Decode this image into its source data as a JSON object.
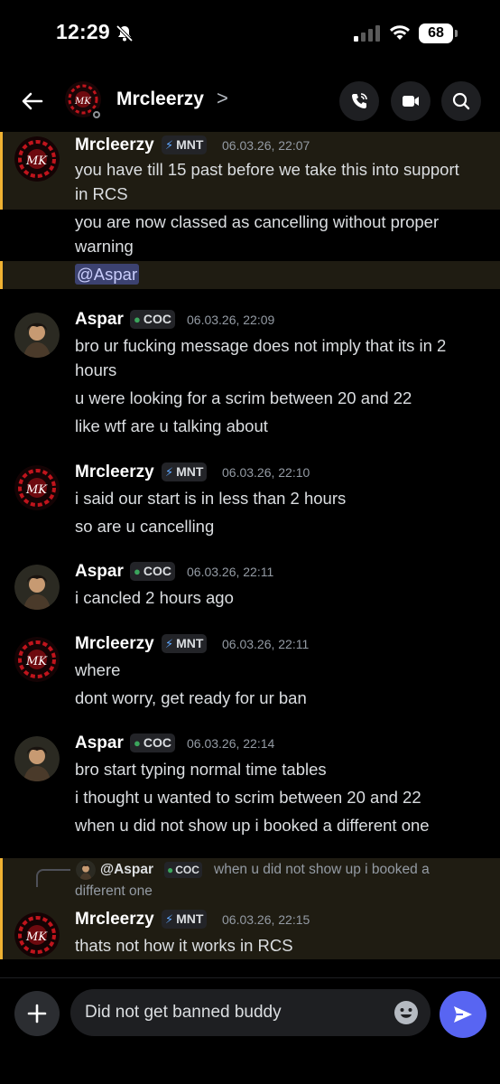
{
  "status_bar": {
    "time": "12:29",
    "battery": "68"
  },
  "header": {
    "name": "Mrcleerzy",
    "chevron": ">"
  },
  "messages": [
    {
      "user": "Mrcleerzy",
      "tag": "MNT",
      "time": "06.03.26, 22:07",
      "lines": [
        "you have till 15 past before we take this into support",
        "in RCS",
        "you are now classed as cancelling without proper",
        "warning",
        "@Aspar"
      ]
    },
    {
      "user": "Aspar",
      "tag": "COC",
      "time": "06.03.26, 22:09",
      "lines": [
        "bro ur fucking message does not imply that its in 2",
        "hours",
        "u were looking for a scrim between 20 and 22",
        "like wtf are u talking about"
      ]
    },
    {
      "user": "Mrcleerzy",
      "tag": "MNT",
      "time": "06.03.26, 22:10",
      "lines": [
        "i said our start is in less than 2 hours",
        "so are u cancelling"
      ]
    },
    {
      "user": "Aspar",
      "tag": "COC",
      "time": "06.03.26, 22:11",
      "lines": [
        "i cancled 2 hours ago"
      ]
    },
    {
      "user": "Mrcleerzy",
      "tag": "MNT",
      "time": "06.03.26, 22:11",
      "lines": [
        "where",
        "dont worry, get ready for ur ban"
      ]
    },
    {
      "user": "Aspar",
      "tag": "COC",
      "time": "06.03.26, 22:14",
      "lines": [
        "bro start typing normal time tables",
        "i thought u wanted to scrim between 20 and 22",
        "when u did not show up i booked a different one"
      ]
    },
    {
      "reply": {
        "name": "@Aspar",
        "tag": "COC",
        "text_1": "when u did not show up i booked a",
        "text_2": "different one"
      },
      "user": "Mrcleerzy",
      "tag": "MNT",
      "time": "06.03.26, 22:15",
      "lines": [
        "thats not how it works in RCS"
      ]
    }
  ],
  "composer": {
    "value": "Did not get banned buddy"
  },
  "colors": {
    "accent": "#5865f2",
    "highlight_bar": "#f0b232",
    "highlight_bg": "#1f1c12",
    "coc_green": "#3ba55c"
  }
}
